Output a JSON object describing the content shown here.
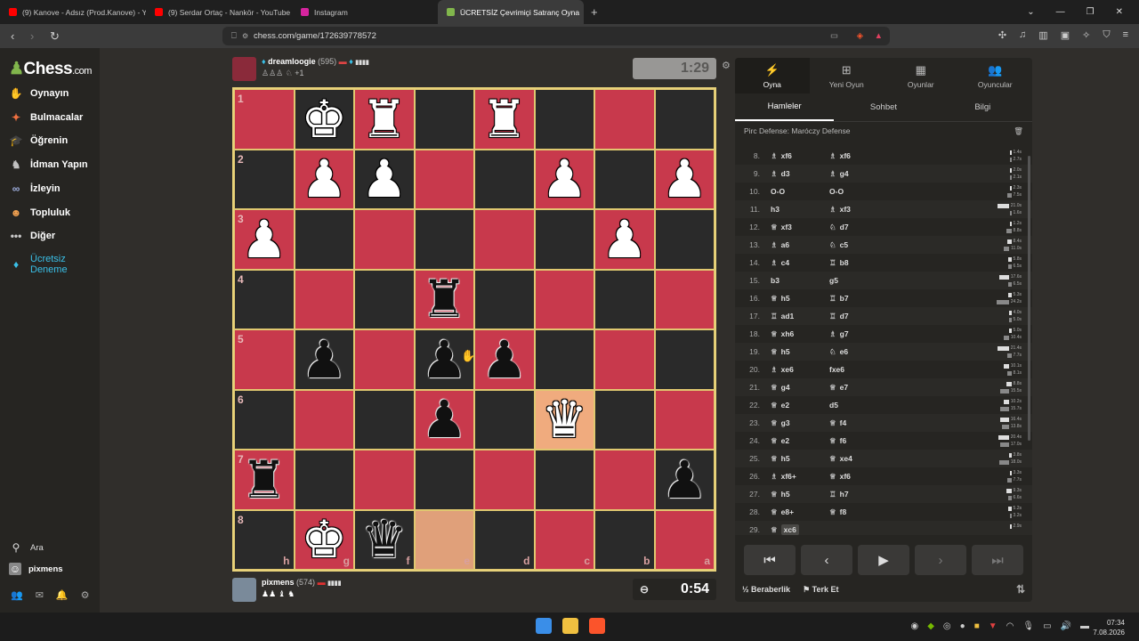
{
  "browser": {
    "tabs": [
      {
        "title": "(9) Kanove - Adsız (Prod.Kanove) - Yo",
        "icon": "youtube-icon",
        "color": "#ff0000"
      },
      {
        "title": "(9) Serdar Ortaç - Nankör - YouTube",
        "icon": "youtube-icon",
        "color": "#ff0000"
      },
      {
        "title": "Instagram",
        "icon": "instagram-icon",
        "color": "#d6249f"
      },
      {
        "title": "ÜCRETSİZ Çevrimiçi Satranç Oyna",
        "icon": "chess-pawn-icon",
        "color": "#81b64c",
        "active": true
      }
    ],
    "url": "chess.com/game/172639778572"
  },
  "sidebar": {
    "logo_main": "Chess",
    "logo_suffix": ".com",
    "items": [
      {
        "label": "Oynayın",
        "icon": "play-hand-icon",
        "color": "#f0b070"
      },
      {
        "label": "Bulmacalar",
        "icon": "puzzle-icon",
        "color": "#f07040"
      },
      {
        "label": "Öğrenin",
        "icon": "learn-cap-icon",
        "color": "#4aa0e0"
      },
      {
        "label": "İdman Yapın",
        "icon": "train-icon",
        "color": "#c0c0c0"
      },
      {
        "label": "İzleyin",
        "icon": "binoculars-icon",
        "color": "#a0b0e0"
      },
      {
        "label": "Topluluk",
        "icon": "community-icon",
        "color": "#f0a050"
      },
      {
        "label": "Diğer",
        "icon": "more-dots-icon",
        "color": "#ccc"
      },
      {
        "label": "Ücretsiz Deneme",
        "icon": "diamond-icon",
        "color": "#3ac0e8"
      }
    ],
    "bottom": {
      "search": "Ara",
      "user": "pixmens"
    }
  },
  "top_player": {
    "name": "dreamloogie",
    "rating": "(595)",
    "captured": "♙♙♙ ♘ +1",
    "clock": "1:29"
  },
  "bottom_player": {
    "name": "pixmens",
    "rating": "(574)",
    "captured": "♟♟ ♝ ♞",
    "clock": "0:54"
  },
  "board": {
    "ranks": [
      "1",
      "2",
      "3",
      "4",
      "5",
      "6",
      "7",
      "8"
    ],
    "files": [
      "h",
      "g",
      "f",
      "e",
      "d",
      "c",
      "b",
      "a"
    ],
    "rows": [
      [
        "",
        "wK",
        "wR",
        "",
        "wR",
        "",
        "",
        ""
      ],
      [
        "",
        "wP",
        "wP",
        "",
        "",
        "wP",
        "",
        "wP"
      ],
      [
        "wP",
        "",
        "",
        "",
        "",
        "",
        "wP",
        ""
      ],
      [
        "",
        "",
        "",
        "bR",
        "",
        "",
        "",
        ""
      ],
      [
        "",
        "bP",
        "",
        "bP",
        "bP",
        "",
        "",
        ""
      ],
      [
        "",
        "",
        "",
        "bP",
        "",
        "wQ",
        "",
        ""
      ],
      [
        "bR",
        "",
        "",
        "",
        "",
        "",
        "",
        "bP"
      ],
      [
        "",
        "wK",
        "bQ",
        "",
        "",
        "",
        "",
        ""
      ]
    ]
  },
  "panel": {
    "tabs": [
      {
        "label": "Oyna",
        "icon": "lightning-icon"
      },
      {
        "label": "Yeni Oyun",
        "icon": "plus-square-icon"
      },
      {
        "label": "Oyunlar",
        "icon": "board-icon"
      },
      {
        "label": "Oyuncular",
        "icon": "players-icon"
      }
    ],
    "subtabs": [
      "Hamleler",
      "Sohbet",
      "Bilgi"
    ],
    "opening": "Pirc Defense: Maróczy Defense",
    "moves": [
      {
        "n": "8.",
        "w": "xf6",
        "wp": "♗",
        "b": "xf6",
        "bp": "♗",
        "tw": "1.4s",
        "tb": "2.7s"
      },
      {
        "n": "9.",
        "w": "d3",
        "wp": "♗",
        "b": "g4",
        "bp": "♗",
        "tw": "2.0s",
        "tb": "2.1s"
      },
      {
        "n": "10.",
        "w": "O-O",
        "wp": "",
        "b": "O-O",
        "bp": "",
        "tw": "2.3s",
        "tb": "7.5s"
      },
      {
        "n": "11.",
        "w": "h3",
        "wp": "",
        "b": "xf3",
        "bp": "♗",
        "tw": "21.0s",
        "tb": "1.6s"
      },
      {
        "n": "12.",
        "w": "xf3",
        "wp": "♕",
        "b": "d7",
        "bp": "♘",
        "tw": "1.2s",
        "tb": "8.8s"
      },
      {
        "n": "13.",
        "w": "a6",
        "wp": "♗",
        "b": "c5",
        "bp": "♘",
        "tw": "8.4s",
        "tb": "11.0s"
      },
      {
        "n": "14.",
        "w": "c4",
        "wp": "♗",
        "b": "b8",
        "bp": "♖",
        "tw": "5.8s",
        "tb": "6.5s"
      },
      {
        "n": "15.",
        "w": "b3",
        "wp": "",
        "b": "g5",
        "bp": "",
        "tw": "17.6s",
        "tb": "6.5s"
      },
      {
        "n": "16.",
        "w": "h5",
        "wp": "♕",
        "b": "b7",
        "bp": "♖",
        "tw": "5.3s",
        "tb": "24.2s"
      },
      {
        "n": "17.",
        "w": "ad1",
        "wp": "♖",
        "b": "d7",
        "bp": "♖",
        "tw": "4.0s",
        "tb": "5.0s"
      },
      {
        "n": "18.",
        "w": "xh6",
        "wp": "♕",
        "b": "g7",
        "bp": "♗",
        "tw": "5.0s",
        "tb": "10.4s"
      },
      {
        "n": "19.",
        "w": "h5",
        "wp": "♕",
        "b": "e6",
        "bp": "♘",
        "tw": "21.4s",
        "tb": "7.7s"
      },
      {
        "n": "20.",
        "w": "xe6",
        "wp": "♗",
        "b": "fxe6",
        "bp": "",
        "tw": "10.1s",
        "tb": "8.1s"
      },
      {
        "n": "21.",
        "w": "g4",
        "wp": "♕",
        "b": "e7",
        "bp": "♕",
        "tw": "8.8s",
        "tb": "15.5s"
      },
      {
        "n": "22.",
        "w": "e2",
        "wp": "♕",
        "b": "d5",
        "bp": "",
        "tw": "10.2s",
        "tb": "15.7s"
      },
      {
        "n": "23.",
        "w": "g3",
        "wp": "♕",
        "b": "f4",
        "bp": "♕",
        "tw": "16.4s",
        "tb": "13.8s"
      },
      {
        "n": "24.",
        "w": "e2",
        "wp": "♕",
        "b": "f6",
        "bp": "♕",
        "tw": "20.4s",
        "tb": "17.0s"
      },
      {
        "n": "25.",
        "w": "h5",
        "wp": "♕",
        "b": "xe4",
        "bp": "♕",
        "tw": "3.8s",
        "tb": "18.0s"
      },
      {
        "n": "26.",
        "w": "xf6+",
        "wp": "♗",
        "b": "xf6",
        "bp": "♕",
        "tw": "3.3s",
        "tb": "7.7s"
      },
      {
        "n": "27.",
        "w": "h5",
        "wp": "♕",
        "b": "h7",
        "bp": "♖",
        "tw": "9.3s",
        "tb": "6.6s"
      },
      {
        "n": "28.",
        "w": "e8+",
        "wp": "♕",
        "b": "f8",
        "bp": "♕",
        "tw": "5.2s",
        "tb": "3.2s"
      },
      {
        "n": "29.",
        "w": "xc6",
        "wp": "♕",
        "b": "",
        "bp": "",
        "tw": "2.9s",
        "tb": ""
      }
    ],
    "footer": {
      "draw": "Beraberlik",
      "draw_prefix": "½",
      "resign": "Terk Et"
    }
  },
  "taskbar": {
    "time": "07:34",
    "date": "7.08.2026"
  }
}
